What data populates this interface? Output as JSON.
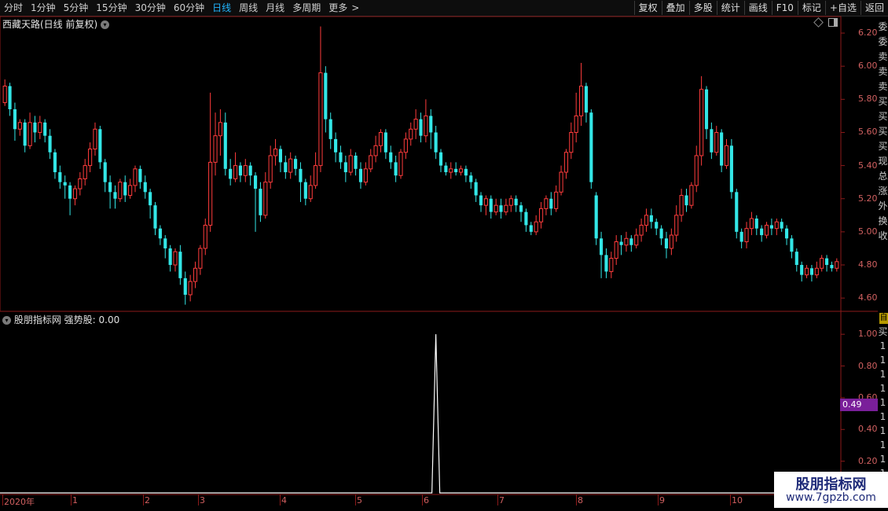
{
  "toolbar": {
    "periods": [
      "分时",
      "1分钟",
      "5分钟",
      "15分钟",
      "30分钟",
      "60分钟",
      "日线",
      "周线",
      "月线",
      "多周期",
      "更多"
    ],
    "active_period": "日线",
    "more_arrow": ">",
    "actions": [
      "复权",
      "叠加",
      "多股",
      "统计",
      "画线",
      "F10",
      "标记",
      "+自选",
      "返回"
    ]
  },
  "main_chart": {
    "title": "西藏天路(日线 前复权)",
    "price_axis": [
      "6.20",
      "6.00",
      "5.80",
      "5.60",
      "5.40",
      "5.20",
      "5.00",
      "4.80",
      "4.60"
    ],
    "up_color": "#ff3c3c",
    "down_color": "#33e6e6",
    "border_color": "#8b1a1a"
  },
  "indicator": {
    "title": "股朋指标网",
    "series_label": "强势股: 0.00",
    "axis": [
      "1.00",
      "0.80",
      "0.60",
      "0.40",
      "0.20"
    ],
    "cursor_value": "0.49"
  },
  "date_axis": [
    "2020年",
    "1",
    "2",
    "3",
    "4",
    "5",
    "6",
    "7",
    "8",
    "9",
    "10"
  ],
  "right_panel_chars": [
    "委",
    "委",
    "卖",
    "卖",
    "卖",
    "买",
    "买",
    "买",
    "买",
    "现",
    "总",
    "涨",
    "外",
    "换",
    "收"
  ],
  "right_panel_lower_chars": [
    "买",
    "1",
    "1",
    "1",
    "1",
    "1",
    "1",
    "1",
    "1",
    "1",
    "1",
    "1",
    "1"
  ],
  "right_panel_badge": "自",
  "watermark": {
    "title": "股朋指标网",
    "url": "www.7gpzb.com"
  },
  "chart_data": {
    "type": "candlestick",
    "y_range": [
      4.52,
      6.3
    ],
    "candles": [
      [
        5.78,
        5.88,
        5.76,
        5.92
      ],
      [
        5.88,
        5.74,
        5.7,
        5.9
      ],
      [
        5.74,
        5.62,
        5.55,
        5.78
      ],
      [
        5.62,
        5.66,
        5.58,
        5.68
      ],
      [
        5.66,
        5.52,
        5.48,
        5.68
      ],
      [
        5.52,
        5.66,
        5.5,
        5.72
      ],
      [
        5.66,
        5.6,
        5.54,
        5.7
      ],
      [
        5.6,
        5.66,
        5.56,
        5.7
      ],
      [
        5.66,
        5.58,
        5.54,
        5.68
      ],
      [
        5.58,
        5.48,
        5.44,
        5.62
      ],
      [
        5.48,
        5.36,
        5.32,
        5.5
      ],
      [
        5.36,
        5.3,
        5.26,
        5.4
      ],
      [
        5.3,
        5.28,
        5.2,
        5.34
      ],
      [
        5.28,
        5.2,
        5.1,
        5.3
      ],
      [
        5.2,
        5.26,
        5.16,
        5.28
      ],
      [
        5.26,
        5.32,
        5.22,
        5.36
      ],
      [
        5.32,
        5.4,
        5.28,
        5.44
      ],
      [
        5.4,
        5.5,
        5.36,
        5.54
      ],
      [
        5.5,
        5.62,
        5.46,
        5.66
      ],
      [
        5.62,
        5.42,
        5.38,
        5.64
      ],
      [
        5.42,
        5.3,
        5.24,
        5.44
      ],
      [
        5.3,
        5.24,
        5.14,
        5.34
      ],
      [
        5.24,
        5.2,
        5.14,
        5.28
      ],
      [
        5.2,
        5.3,
        5.18,
        5.32
      ],
      [
        5.3,
        5.22,
        5.18,
        5.34
      ],
      [
        5.22,
        5.28,
        5.2,
        5.32
      ],
      [
        5.28,
        5.38,
        5.24,
        5.4
      ],
      [
        5.38,
        5.3,
        5.26,
        5.4
      ],
      [
        5.3,
        5.24,
        5.2,
        5.34
      ],
      [
        5.24,
        5.16,
        5.08,
        5.26
      ],
      [
        5.16,
        5.02,
        4.98,
        5.18
      ],
      [
        5.02,
        4.96,
        4.92,
        5.04
      ],
      [
        4.96,
        4.9,
        4.84,
        4.98
      ],
      [
        4.9,
        4.8,
        4.76,
        4.92
      ],
      [
        4.8,
        4.88,
        4.76,
        4.9
      ],
      [
        4.88,
        4.72,
        4.68,
        4.92
      ],
      [
        4.72,
        4.62,
        4.56,
        4.76
      ],
      [
        4.62,
        4.7,
        4.58,
        4.74
      ],
      [
        4.7,
        4.78,
        4.66,
        4.82
      ],
      [
        4.78,
        4.9,
        4.74,
        4.92
      ],
      [
        4.9,
        5.04,
        4.86,
        5.08
      ],
      [
        5.04,
        5.42,
        5.0,
        5.84
      ],
      [
        5.42,
        5.58,
        5.34,
        5.72
      ],
      [
        5.58,
        5.66,
        5.46,
        5.74
      ],
      [
        5.66,
        5.38,
        5.34,
        5.72
      ],
      [
        5.38,
        5.32,
        5.28,
        5.44
      ],
      [
        5.32,
        5.4,
        5.3,
        5.48
      ],
      [
        5.4,
        5.34,
        5.3,
        5.42
      ],
      [
        5.34,
        5.4,
        5.3,
        5.44
      ],
      [
        5.4,
        5.34,
        5.28,
        5.42
      ],
      [
        5.34,
        5.26,
        5.0,
        5.36
      ],
      [
        5.26,
        5.1,
        5.06,
        5.3
      ],
      [
        5.1,
        5.3,
        5.08,
        5.36
      ],
      [
        5.3,
        5.46,
        5.26,
        5.52
      ],
      [
        5.46,
        5.5,
        5.4,
        5.56
      ],
      [
        5.5,
        5.42,
        5.36,
        5.52
      ],
      [
        5.42,
        5.36,
        5.32,
        5.46
      ],
      [
        5.36,
        5.44,
        5.32,
        5.48
      ],
      [
        5.44,
        5.38,
        5.34,
        5.46
      ],
      [
        5.38,
        5.3,
        5.18,
        5.42
      ],
      [
        5.3,
        5.2,
        5.16,
        5.32
      ],
      [
        5.2,
        5.28,
        5.18,
        5.34
      ],
      [
        5.28,
        5.4,
        5.26,
        5.48
      ],
      [
        5.4,
        5.96,
        5.36,
        6.24
      ],
      [
        5.96,
        5.68,
        5.6,
        6.0
      ],
      [
        5.68,
        5.56,
        5.5,
        5.72
      ],
      [
        5.56,
        5.48,
        5.42,
        5.6
      ],
      [
        5.48,
        5.42,
        5.38,
        5.52
      ],
      [
        5.42,
        5.36,
        5.3,
        5.46
      ],
      [
        5.36,
        5.46,
        5.34,
        5.5
      ],
      [
        5.46,
        5.38,
        5.34,
        5.48
      ],
      [
        5.38,
        5.3,
        5.26,
        5.42
      ],
      [
        5.3,
        5.38,
        5.28,
        5.42
      ],
      [
        5.38,
        5.46,
        5.36,
        5.5
      ],
      [
        5.46,
        5.52,
        5.42,
        5.58
      ],
      [
        5.52,
        5.6,
        5.48,
        5.62
      ],
      [
        5.6,
        5.48,
        5.44,
        5.62
      ],
      [
        5.48,
        5.42,
        5.38,
        5.52
      ],
      [
        5.42,
        5.34,
        5.3,
        5.46
      ],
      [
        5.34,
        5.48,
        5.32,
        5.5
      ],
      [
        5.48,
        5.56,
        5.44,
        5.6
      ],
      [
        5.56,
        5.62,
        5.52,
        5.66
      ],
      [
        5.62,
        5.68,
        5.56,
        5.74
      ],
      [
        5.68,
        5.58,
        5.54,
        5.72
      ],
      [
        5.58,
        5.7,
        5.54,
        5.8
      ],
      [
        5.7,
        5.6,
        5.5,
        5.74
      ],
      [
        5.6,
        5.48,
        5.44,
        5.64
      ],
      [
        5.48,
        5.4,
        5.36,
        5.5
      ],
      [
        5.4,
        5.36,
        5.34,
        5.42
      ],
      [
        5.36,
        5.38,
        5.32,
        5.42
      ],
      [
        5.38,
        5.36,
        5.34,
        5.42
      ],
      [
        5.36,
        5.38,
        5.34,
        5.4
      ],
      [
        5.38,
        5.34,
        5.3,
        5.4
      ],
      [
        5.34,
        5.3,
        5.26,
        5.36
      ],
      [
        5.3,
        5.22,
        5.18,
        5.32
      ],
      [
        5.22,
        5.16,
        5.12,
        5.24
      ],
      [
        5.16,
        5.2,
        5.1,
        5.22
      ],
      [
        5.2,
        5.12,
        5.08,
        5.22
      ],
      [
        5.12,
        5.16,
        5.1,
        5.2
      ],
      [
        5.16,
        5.12,
        5.08,
        5.2
      ],
      [
        5.12,
        5.16,
        5.1,
        5.2
      ],
      [
        5.16,
        5.2,
        5.12,
        5.22
      ],
      [
        5.2,
        5.16,
        5.12,
        5.22
      ],
      [
        5.16,
        5.12,
        5.06,
        5.18
      ],
      [
        5.12,
        5.04,
        5.0,
        5.14
      ],
      [
        5.04,
        5.0,
        4.98,
        5.06
      ],
      [
        5.0,
        5.06,
        4.98,
        5.1
      ],
      [
        5.06,
        5.14,
        5.02,
        5.18
      ],
      [
        5.14,
        5.2,
        5.1,
        5.22
      ],
      [
        5.2,
        5.14,
        5.1,
        5.24
      ],
      [
        5.14,
        5.24,
        5.12,
        5.28
      ],
      [
        5.24,
        5.36,
        5.22,
        5.4
      ],
      [
        5.36,
        5.48,
        5.32,
        5.5
      ],
      [
        5.48,
        5.6,
        5.44,
        5.66
      ],
      [
        5.6,
        5.7,
        5.54,
        5.84
      ],
      [
        5.7,
        5.88,
        5.64,
        6.02
      ],
      [
        5.88,
        5.72,
        5.66,
        5.9
      ],
      [
        5.72,
        5.3,
        5.26,
        5.74
      ],
      [
        5.22,
        4.96,
        4.92,
        5.24
      ],
      [
        4.96,
        4.86,
        4.72,
        5.0
      ],
      [
        4.86,
        4.76,
        4.72,
        4.9
      ],
      [
        4.76,
        4.84,
        4.72,
        4.88
      ],
      [
        4.84,
        4.94,
        4.8,
        4.98
      ],
      [
        4.94,
        4.92,
        4.86,
        4.98
      ],
      [
        4.92,
        4.96,
        4.88,
        5.0
      ],
      [
        4.96,
        4.92,
        4.88,
        4.98
      ],
      [
        4.92,
        4.98,
        4.9,
        5.02
      ],
      [
        4.98,
        5.04,
        4.94,
        5.08
      ],
      [
        5.04,
        5.1,
        5.0,
        5.14
      ],
      [
        5.1,
        5.06,
        5.02,
        5.14
      ],
      [
        5.06,
        5.02,
        4.98,
        5.08
      ],
      [
        5.02,
        4.96,
        4.92,
        5.04
      ],
      [
        4.96,
        4.9,
        4.84,
        5.0
      ],
      [
        4.9,
        4.98,
        4.86,
        5.02
      ],
      [
        4.98,
        5.1,
        4.94,
        5.16
      ],
      [
        5.1,
        5.22,
        5.06,
        5.26
      ],
      [
        5.22,
        5.16,
        5.12,
        5.26
      ],
      [
        5.16,
        5.28,
        5.14,
        5.3
      ],
      [
        5.28,
        5.46,
        5.24,
        5.52
      ],
      [
        5.46,
        5.86,
        5.4,
        5.94
      ],
      [
        5.86,
        5.62,
        5.56,
        5.88
      ],
      [
        5.62,
        5.48,
        5.44,
        5.66
      ],
      [
        5.48,
        5.6,
        5.46,
        5.64
      ],
      [
        5.6,
        5.4,
        5.36,
        5.62
      ],
      [
        5.4,
        5.52,
        5.38,
        5.56
      ],
      [
        5.52,
        5.24,
        5.2,
        5.56
      ],
      [
        5.24,
        5.0,
        4.96,
        5.26
      ],
      [
        5.0,
        4.94,
        4.9,
        5.02
      ],
      [
        4.94,
        5.02,
        4.9,
        5.06
      ],
      [
        5.02,
        5.08,
        4.98,
        5.12
      ],
      [
        5.08,
        5.02,
        4.98,
        5.1
      ],
      [
        5.02,
        4.98,
        4.94,
        5.04
      ],
      [
        4.98,
        5.04,
        4.96,
        5.06
      ],
      [
        5.04,
        5.02,
        4.98,
        5.08
      ],
      [
        5.02,
        5.06,
        4.98,
        5.08
      ],
      [
        5.06,
        5.02,
        5.0,
        5.08
      ],
      [
        5.02,
        4.96,
        4.92,
        5.04
      ],
      [
        4.96,
        4.88,
        4.84,
        4.98
      ],
      [
        4.88,
        4.8,
        4.76,
        4.9
      ],
      [
        4.8,
        4.74,
        4.7,
        4.82
      ],
      [
        4.74,
        4.78,
        4.72,
        4.8
      ],
      [
        4.78,
        4.74,
        4.7,
        4.8
      ],
      [
        4.74,
        4.78,
        4.72,
        4.82
      ],
      [
        4.78,
        4.84,
        4.76,
        4.86
      ],
      [
        4.84,
        4.8,
        4.76,
        4.86
      ],
      [
        4.8,
        4.78,
        4.76,
        4.82
      ],
      [
        4.78,
        4.82,
        4.76,
        4.84
      ]
    ],
    "indicator_series": {
      "name": "强势股",
      "spike_index": 86,
      "spike_value": 1.0,
      "y_range": [
        0,
        1.1
      ]
    }
  }
}
